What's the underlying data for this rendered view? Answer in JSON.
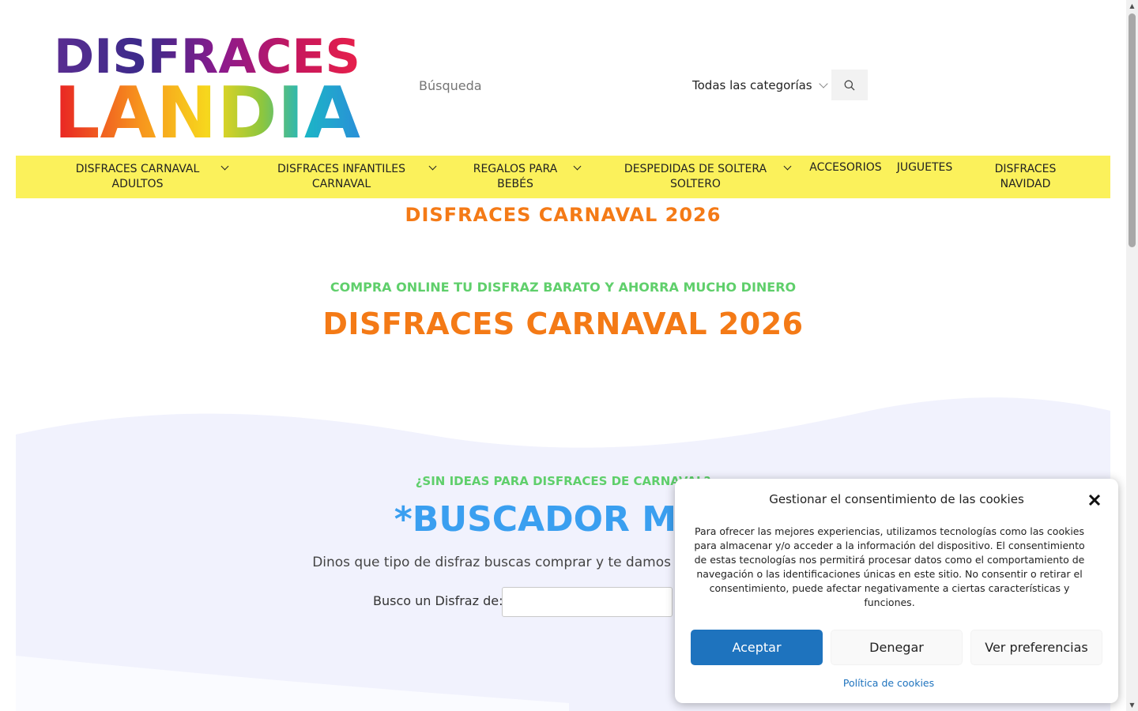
{
  "header": {
    "logo": {
      "line1": "DISFRACES",
      "line2": "LANDIA"
    },
    "search": {
      "placeholder": "Búsqueda",
      "category": "Todas las categorías"
    }
  },
  "nav": {
    "items": [
      {
        "line1": "DISFRACES CARNAVAL",
        "line2": "ADULTOS",
        "has_submenu": true
      },
      {
        "line1": "DISFRACES INFANTILES",
        "line2": "CARNAVAL",
        "has_submenu": true
      },
      {
        "line1": "REGALOS PARA",
        "line2": "BEBÉS",
        "has_submenu": true
      },
      {
        "line1": "DESPEDIDAS DE SOLTERA",
        "line2": "SOLTERO",
        "has_submenu": true
      },
      {
        "line1": "ACCESORIOS",
        "line2": "",
        "has_submenu": false
      },
      {
        "line1": "JUGUETES",
        "line2": "",
        "has_submenu": false
      },
      {
        "line1": "DISFRACES",
        "line2": "NAVIDAD",
        "has_submenu": false
      }
    ]
  },
  "page": {
    "site_title": "DISFRACES CARNAVAL 2026",
    "subtitle": "COMPRA ONLINE TU DISFRAZ BARATO Y AHORRA MUCHO DINERO",
    "main_title": "DISFRACES CARNAVAL 2026"
  },
  "finder": {
    "kicker": "¿SIN IDEAS PARA DISFRACES DE CARNAVAL?",
    "title": "*BUSCADOR MÁG",
    "description": "Dinos que tipo de disfraz buscas comprar y te damos cantidad de Ideas, D",
    "label": "Busco un Disfraz de:"
  },
  "cookie": {
    "title": "Gestionar el consentimiento de las cookies",
    "text": "Para ofrecer las mejores experiencias, utilizamos tecnologías como las cookies para almacenar y/o acceder a la información del dispositivo. El consentimiento de estas tecnologías nos permitirá procesar datos como el comportamiento de navegación o las identificaciones únicas en este sitio. No consentir o retirar el consentimiento, puede afectar negativamente a ciertas características y funciones.",
    "accept": "Aceptar",
    "deny": "Denegar",
    "preferences": "Ver preferencias",
    "policy_link": "Política de cookies"
  },
  "colors": {
    "nav_bg": "#fbf15b",
    "orange": "#f47a16",
    "green": "#5fcf6b",
    "blue": "#3a9ff0",
    "accept_blue": "#1e73be"
  }
}
